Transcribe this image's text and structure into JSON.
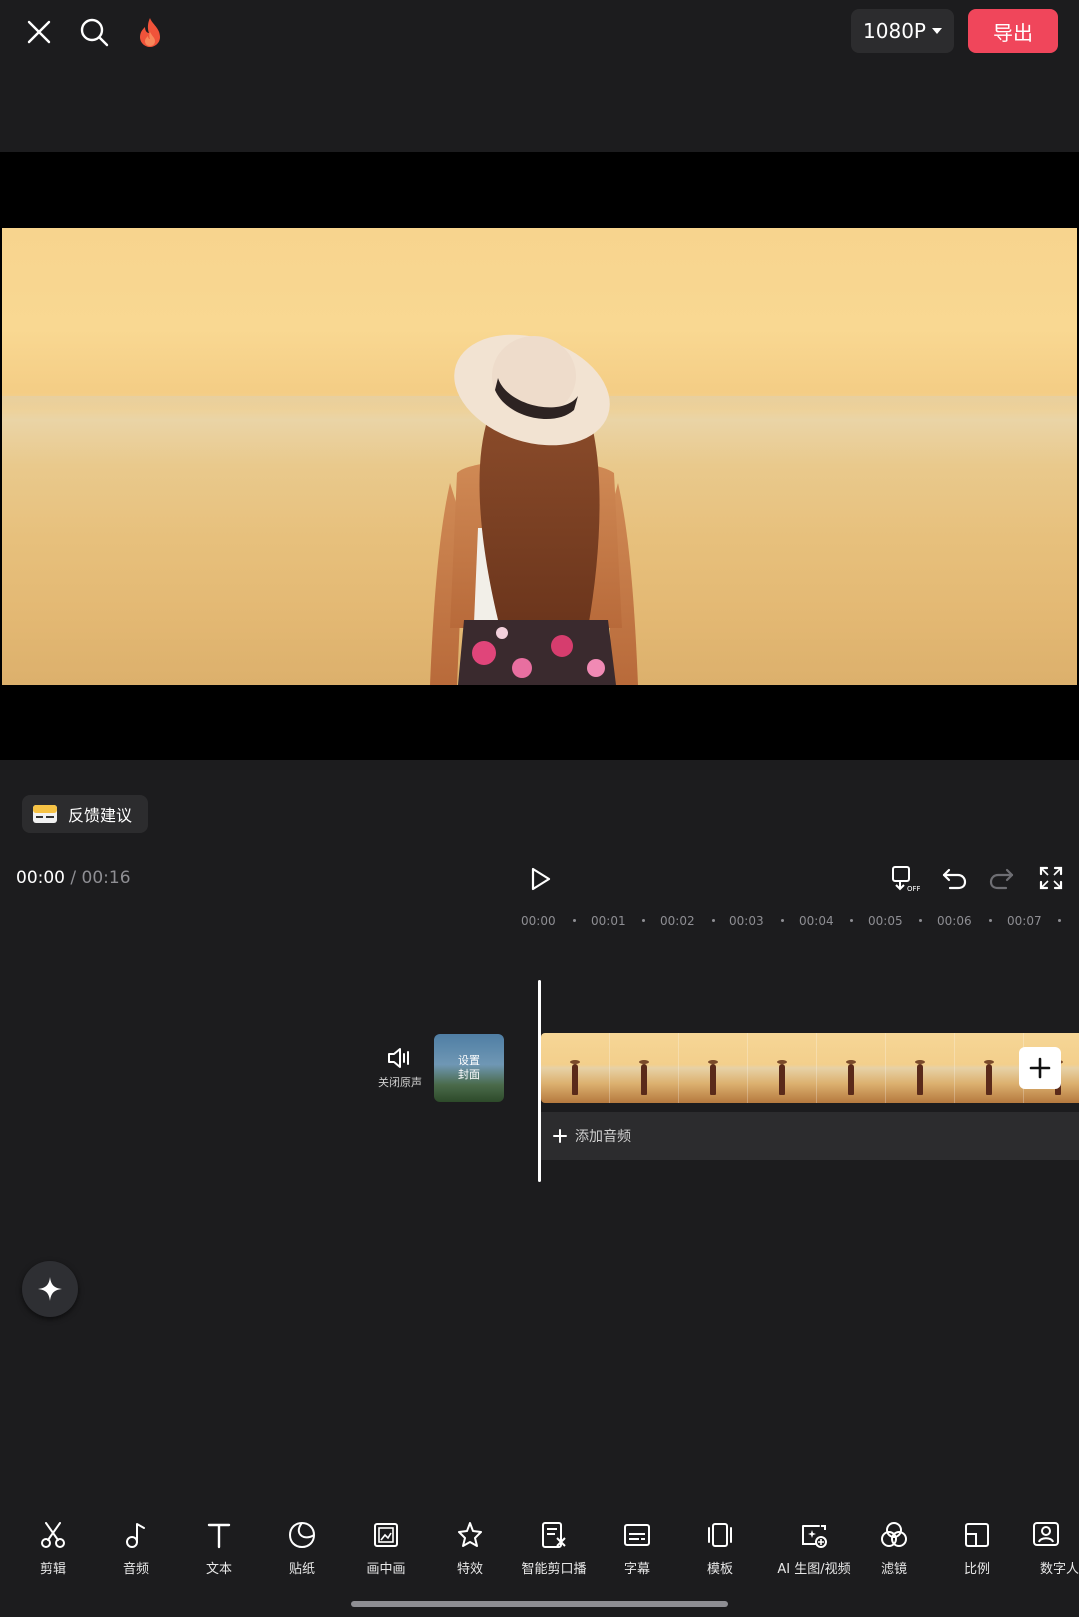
{
  "header": {
    "resolution_label": "1080P",
    "export_label": "导出",
    "accent_color": "#f0465b"
  },
  "feedback": {
    "label": "反馈建议"
  },
  "playback": {
    "current_time": "00:00",
    "separator": "/",
    "total_time": "00:16"
  },
  "ruler": {
    "labels": [
      "00:00",
      "00:01",
      "00:02",
      "00:03",
      "00:04",
      "00:05",
      "00:06",
      "00:07"
    ]
  },
  "tracks": {
    "mute_label": "关闭原声",
    "cover_label": "设置封面",
    "add_audio_label": "添加音频"
  },
  "toolbar": {
    "items": [
      {
        "label": "剪辑",
        "icon": "scissors-icon"
      },
      {
        "label": "音频",
        "icon": "music-note-icon"
      },
      {
        "label": "文本",
        "icon": "text-icon"
      },
      {
        "label": "贴纸",
        "icon": "sticker-icon"
      },
      {
        "label": "画中画",
        "icon": "picture-in-picture-icon"
      },
      {
        "label": "特效",
        "icon": "effects-star-icon"
      },
      {
        "label": "智能剪口播",
        "icon": "smart-cut-icon"
      },
      {
        "label": "字幕",
        "icon": "subtitle-icon"
      },
      {
        "label": "模板",
        "icon": "template-icon"
      },
      {
        "label": "AI 生图/视频",
        "icon": "ai-image-icon"
      },
      {
        "label": "滤镜",
        "icon": "filter-icon"
      },
      {
        "label": "比例",
        "icon": "ratio-icon"
      },
      {
        "label": "数字人",
        "icon": "digital-human-icon"
      }
    ]
  }
}
